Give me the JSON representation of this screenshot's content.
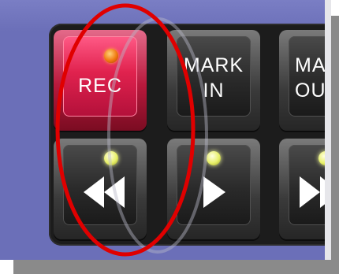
{
  "keys": {
    "rec": {
      "label": "REC",
      "led": "orange"
    },
    "mark_in": {
      "line1": "MARK",
      "line2": "IN"
    },
    "mark_out": {
      "line1": "MAR",
      "line2": "OU"
    },
    "rewind": {
      "icon": "rewind-icon",
      "led": "green"
    },
    "play": {
      "icon": "play-icon",
      "led": "green"
    },
    "forward": {
      "icon": "fast-forward-icon",
      "led": "green"
    }
  },
  "colors": {
    "background": "#6b6fb8",
    "rec_key": "#e0224e",
    "key": "#2a2a2a",
    "annotation_outline": "#e00000",
    "led_orange": "#f07a10",
    "led_green": "#e8f06a"
  }
}
